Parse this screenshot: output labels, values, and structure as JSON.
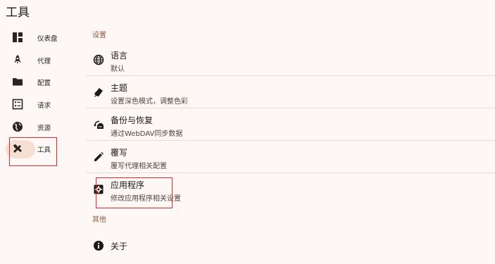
{
  "app": {
    "title": "工具"
  },
  "sidebar": {
    "items": [
      {
        "label": "仪表盘",
        "icon": "dashboard-icon"
      },
      {
        "label": "代理",
        "icon": "rocket-icon"
      },
      {
        "label": "配置",
        "icon": "folder-icon"
      },
      {
        "label": "请求",
        "icon": "list-icon"
      },
      {
        "label": "资源",
        "icon": "globe-icon"
      },
      {
        "label": "工具",
        "icon": "tools-icon",
        "selected": true
      }
    ]
  },
  "main": {
    "sections": [
      {
        "title": "设置",
        "items": [
          {
            "title": "语言",
            "subtitle": "默认",
            "icon": "globe-icon"
          },
          {
            "title": "主题",
            "subtitle": "设置深色模式，调整色彩",
            "icon": "theme-icon"
          },
          {
            "title": "备份与恢复",
            "subtitle": "通过WebDAV同步数据",
            "icon": "backup-icon"
          },
          {
            "title": "覆写",
            "subtitle": "覆写代理相关配置",
            "icon": "edit-icon"
          },
          {
            "title": "应用程序",
            "subtitle": "修改应用程序相关设置",
            "icon": "settings-app-icon"
          }
        ]
      },
      {
        "title": "其他",
        "items": [
          {
            "title": "关于",
            "icon": "info-icon"
          }
        ]
      }
    ]
  },
  "colors": {
    "background": "#fdf8f5",
    "selected_pill": "#f6ded2",
    "section_title": "#8c5b45",
    "highlight": "#e02a2a"
  }
}
